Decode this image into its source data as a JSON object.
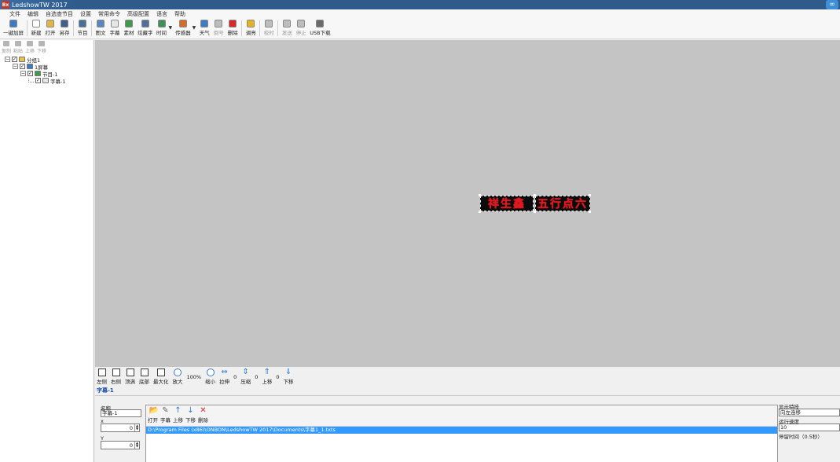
{
  "window": {
    "title": "LedshowTW 2017"
  },
  "menu": [
    "文件",
    "编辑",
    "自选查节目",
    "设置",
    "常用命令",
    "高级配置",
    "语言",
    "帮助"
  ],
  "toolbar": [
    {
      "label": "一键加屏",
      "icon": "add-screen-icon",
      "color": "#3d7ac6"
    },
    {
      "sep": true
    },
    {
      "label": "新建",
      "icon": "new-file-icon",
      "color": "#ffffff"
    },
    {
      "label": "打开",
      "icon": "open-folder-icon",
      "color": "#e1b447"
    },
    {
      "label": "另存",
      "icon": "save-icon",
      "color": "#3f5f8f"
    },
    {
      "sep": true
    },
    {
      "label": "节目",
      "icon": "program-icon",
      "color": "#4a6e9c"
    },
    {
      "sep": true
    },
    {
      "label": "图文",
      "icon": "picture-text-icon",
      "color": "#5b86c4"
    },
    {
      "label": "字幕",
      "icon": "subtitle-icon",
      "color": "#e6e6e6"
    },
    {
      "label": "素材",
      "icon": "material-icon",
      "color": "#3f9a4a"
    },
    {
      "label": "炫藏字",
      "icon": "fancy-text-icon",
      "color": "#4f6fa3"
    },
    {
      "label": "时间",
      "icon": "clock-icon",
      "color": "#3e8f5a",
      "dropdown": true
    },
    {
      "label": "传感器",
      "icon": "sensor-icon",
      "color": "#d36b2a",
      "dropdown": true
    },
    {
      "label": "天气",
      "icon": "weather-icon",
      "color": "#3f7cc6"
    },
    {
      "label": "倒号",
      "icon": "countdown-icon",
      "color": "#bdbdbd",
      "disabled": true
    },
    {
      "label": "删除",
      "icon": "delete-icon",
      "color": "#d32b2b"
    },
    {
      "sep": true
    },
    {
      "label": "调亮",
      "icon": "brightness-icon",
      "color": "#e8b21e"
    },
    {
      "sep": true
    },
    {
      "label": "校时",
      "icon": "sync-time-icon",
      "color": "#bdbdbd",
      "disabled": true
    },
    {
      "sep": true
    },
    {
      "label": "发送",
      "icon": "send-icon",
      "color": "#bdbdbd",
      "disabled": true
    },
    {
      "label": "停止",
      "icon": "stop-icon",
      "color": "#bdbdbd",
      "disabled": true
    },
    {
      "label": "USB下载",
      "icon": "usb-icon",
      "color": "#6b6b6b"
    }
  ],
  "tree_toolbar": [
    "复制",
    "粘贴",
    "上移",
    "下移"
  ],
  "tree": [
    {
      "label": "分组1",
      "indent": 0,
      "exp": "⊟",
      "icon": "folder-icon",
      "color": "#e8c04a"
    },
    {
      "label": "1屏幕",
      "indent": 1,
      "exp": "⊟",
      "icon": "screen-icon",
      "color": "#3d7ac6"
    },
    {
      "label": "节目-1",
      "indent": 2,
      "exp": "⊟",
      "icon": "program-icon",
      "color": "#3f9a4a"
    },
    {
      "label": "字幕-1",
      "indent": 3,
      "exp": "",
      "icon": "subtitle-icon",
      "color": "#e6e6e6"
    }
  ],
  "led": {
    "left_text": "祥生鑫",
    "right_text": "五行点六"
  },
  "zoombar": {
    "buttons": [
      {
        "label": "左侧",
        "icon": "align-left-icon"
      },
      {
        "label": "右侧",
        "icon": "align-right-icon"
      },
      {
        "label": "顶满",
        "icon": "fill-top-icon"
      },
      {
        "label": "底部",
        "icon": "align-bottom-icon"
      },
      {
        "label": "最大化",
        "icon": "maximize-icon"
      }
    ],
    "zoom_in": "放大",
    "zoom_value": "100%",
    "zoom_out": "缩小",
    "stretch": "拉伸",
    "stretch_value": "0",
    "compress": "压缩",
    "compress_value": "0",
    "move_up": "上移",
    "move_value": "0",
    "move_down": "下移"
  },
  "current_item": "字幕-1",
  "props": {
    "name_label": "名称",
    "name_value": "字幕-1",
    "x_label": "x",
    "x_value": "0",
    "y_label": "Y",
    "y_value": "0"
  },
  "file_toolbar": [
    {
      "label": "打开",
      "icon": "open-folder-icon",
      "glyph": "📂",
      "color": "#e1a93a"
    },
    {
      "label": "字幕",
      "icon": "subtitle-icon",
      "glyph": "✎",
      "color": "#666"
    },
    {
      "label": "上移",
      "icon": "arrow-up-icon",
      "glyph": "↑",
      "color": "#2a7bd0"
    },
    {
      "label": "下移",
      "icon": "arrow-down-icon",
      "glyph": "↓",
      "color": "#2a7bd0"
    },
    {
      "label": "删除",
      "icon": "delete-icon",
      "glyph": "✕",
      "color": "#d32b2b"
    }
  ],
  "file_path": "D:\\Program Files (x86)\\ONBON\\LedshowTW 2017\\Documents\\字幕1_1.txts",
  "right_props": {
    "effect_label": "显示特技",
    "effect_value": "向左连移",
    "speed_label": "运行速度",
    "speed_value": "10",
    "stay_label": "停留时间（0.5秒）"
  }
}
